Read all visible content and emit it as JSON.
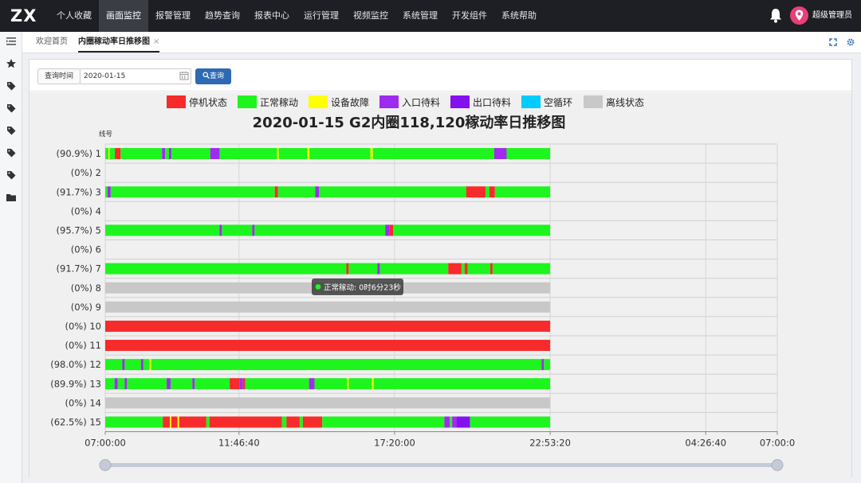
{
  "app": {
    "logo": "ZX",
    "username": "超级管理员"
  },
  "nav": {
    "items": [
      "个人收藏",
      "画面监控",
      "报警管理",
      "趋势查询",
      "报表中心",
      "运行管理",
      "视频监控",
      "系统管理",
      "开发组件",
      "系统帮助"
    ],
    "active_index": 1
  },
  "tabs": [
    {
      "label": "欢迎首页",
      "active": false
    },
    {
      "label": "内圈稼动率日推移图",
      "active": true,
      "close": "×"
    }
  ],
  "leftbar_icons": [
    "menu-toggle-icon",
    "star-icon",
    "tag-icon",
    "tag-icon",
    "tag-icon",
    "tag-icon",
    "tag-icon",
    "folder-icon"
  ],
  "query": {
    "label": "查询时间",
    "date_value": "2020-01-15",
    "button_label": "查询"
  },
  "colors": {
    "stop": "#f72b2b",
    "normal": "#1ef51e",
    "fault": "#ffff00",
    "in_wait": "#9f2bee",
    "out_wait": "#8410f0",
    "idle": "#00ccff",
    "offline": "#c8c8c8",
    "accent": "#2e6ab3"
  },
  "tooltip": {
    "text": "正常稼动: 0时6分23秒",
    "dot_color": "#1ef51e"
  },
  "chart_data": {
    "type": "gantt",
    "title": "2020-01-15 G2内圈118,120稼动率日推移图",
    "ylabel": "线号",
    "legend": [
      {
        "name": "停机状态",
        "key": "stop"
      },
      {
        "name": "正常稼动",
        "key": "normal"
      },
      {
        "name": "设备故障",
        "key": "fault"
      },
      {
        "name": "入口待料",
        "key": "in_wait"
      },
      {
        "name": "出口待料",
        "key": "out_wait"
      },
      {
        "name": "空循环",
        "key": "idle"
      },
      {
        "name": "离线状态",
        "key": "offline"
      }
    ],
    "legend_position": "top",
    "x_ticks": [
      "07:00:00",
      "11:46:40",
      "17:20:00",
      "22:53:20",
      "04:26:40",
      "07:00:0"
    ],
    "x_tick_seconds": [
      0,
      17200,
      37200,
      57200,
      77200,
      86400
    ],
    "x_range_seconds": [
      0,
      86400
    ],
    "data_end_seconds": 57200,
    "grid": true,
    "rows": [
      {
        "line": "1",
        "rate": "(90.9%)",
        "segments": [
          [
            "normal",
            0,
            420
          ],
          [
            "fault",
            420,
            560
          ],
          [
            "normal",
            560,
            1240
          ],
          [
            "stop",
            1240,
            1980
          ],
          [
            "normal",
            1980,
            7300
          ],
          [
            "in_wait",
            7300,
            7700
          ],
          [
            "normal",
            7700,
            8200
          ],
          [
            "in_wait",
            8200,
            8500
          ],
          [
            "normal",
            8500,
            13500
          ],
          [
            "in_wait",
            13500,
            14700
          ],
          [
            "normal",
            14700,
            22100
          ],
          [
            "fault",
            22100,
            22300
          ],
          [
            "normal",
            22300,
            26000
          ],
          [
            "fault",
            26000,
            26250
          ],
          [
            "normal",
            26250,
            34100
          ],
          [
            "fault",
            34100,
            34400
          ],
          [
            "normal",
            34400,
            50000
          ],
          [
            "in_wait",
            50000,
            51600
          ],
          [
            "normal",
            51600,
            57200
          ]
        ]
      },
      {
        "line": "2",
        "rate": "(0%)",
        "segments": []
      },
      {
        "line": "3",
        "rate": "(91.7%)",
        "segments": [
          [
            "normal",
            0,
            300
          ],
          [
            "in_wait",
            300,
            700
          ],
          [
            "normal",
            700,
            21800
          ],
          [
            "stop",
            21800,
            22200
          ],
          [
            "normal",
            22200,
            27000
          ],
          [
            "in_wait",
            27000,
            27500
          ],
          [
            "normal",
            27500,
            46400
          ],
          [
            "stop",
            46400,
            48900
          ],
          [
            "normal",
            48900,
            49400
          ],
          [
            "stop",
            49400,
            50100
          ],
          [
            "normal",
            50100,
            57200
          ]
        ]
      },
      {
        "line": "4",
        "rate": "(0%)",
        "segments": []
      },
      {
        "line": "5",
        "rate": "(95.7%)",
        "segments": [
          [
            "normal",
            0,
            14700
          ],
          [
            "in_wait",
            14700,
            15000
          ],
          [
            "normal",
            15000,
            18900
          ],
          [
            "in_wait",
            18900,
            19200
          ],
          [
            "normal",
            19200,
            36000
          ],
          [
            "in_wait",
            36000,
            36500
          ],
          [
            "stop",
            36500,
            37000
          ],
          [
            "normal",
            37000,
            57200
          ]
        ]
      },
      {
        "line": "6",
        "rate": "(0%)",
        "segments": []
      },
      {
        "line": "7",
        "rate": "(91.7%)",
        "segments": [
          [
            "normal",
            0,
            31000
          ],
          [
            "stop",
            31000,
            31300
          ],
          [
            "normal",
            31300,
            35000
          ],
          [
            "in_wait",
            35000,
            35300
          ],
          [
            "normal",
            35300,
            44100
          ],
          [
            "stop",
            44100,
            45800
          ],
          [
            "normal",
            45800,
            46200
          ],
          [
            "stop",
            46200,
            46600
          ],
          [
            "normal",
            46600,
            49500
          ],
          [
            "stop",
            49500,
            49800
          ],
          [
            "normal",
            49800,
            57200
          ]
        ]
      },
      {
        "line": "8",
        "rate": "(0%)",
        "segments": [
          [
            "offline",
            0,
            57200
          ]
        ]
      },
      {
        "line": "9",
        "rate": "(0%)",
        "segments": [
          [
            "offline",
            0,
            57200
          ]
        ]
      },
      {
        "line": "10",
        "rate": "(0%)",
        "segments": [
          [
            "stop",
            0,
            57200
          ]
        ]
      },
      {
        "line": "11",
        "rate": "(0%)",
        "segments": [
          [
            "stop",
            0,
            57200
          ]
        ]
      },
      {
        "line": "12",
        "rate": "(98.0%)",
        "segments": [
          [
            "normal",
            0,
            2200
          ],
          [
            "in_wait",
            2200,
            2500
          ],
          [
            "normal",
            2500,
            4600
          ],
          [
            "in_wait",
            4600,
            4900
          ],
          [
            "normal",
            4900,
            5700
          ],
          [
            "fault",
            5700,
            5900
          ],
          [
            "normal",
            5900,
            56100
          ],
          [
            "in_wait",
            56100,
            56400
          ],
          [
            "normal",
            56400,
            57200
          ]
        ]
      },
      {
        "line": "13",
        "rate": "(89.9%)",
        "segments": [
          [
            "normal",
            0,
            1200
          ],
          [
            "in_wait",
            1200,
            1600
          ],
          [
            "normal",
            1600,
            2500
          ],
          [
            "in_wait",
            2500,
            2800
          ],
          [
            "normal",
            2800,
            7900
          ],
          [
            "in_wait",
            7900,
            8400
          ],
          [
            "normal",
            8400,
            11200
          ],
          [
            "in_wait",
            11200,
            11500
          ],
          [
            "normal",
            11500,
            16000
          ],
          [
            "stop",
            16000,
            17300
          ],
          [
            "in_wait",
            17300,
            17700
          ],
          [
            "stop",
            17700,
            18000
          ],
          [
            "normal",
            18000,
            26200
          ],
          [
            "in_wait",
            26200,
            26900
          ],
          [
            "normal",
            26900,
            31100
          ],
          [
            "fault",
            31100,
            31300
          ],
          [
            "normal",
            31300,
            34300
          ],
          [
            "fault",
            34300,
            34500
          ],
          [
            "normal",
            34500,
            57200
          ]
        ]
      },
      {
        "line": "14",
        "rate": "(0%)",
        "segments": [
          [
            "offline",
            0,
            57200
          ]
        ]
      },
      {
        "line": "15",
        "rate": "(62.5%)",
        "segments": [
          [
            "normal",
            0,
            7400
          ],
          [
            "stop",
            7400,
            8300
          ],
          [
            "fault",
            8300,
            8500
          ],
          [
            "stop",
            8500,
            9300
          ],
          [
            "fault",
            9300,
            9500
          ],
          [
            "stop",
            9500,
            13000
          ],
          [
            "normal",
            13000,
            13400
          ],
          [
            "stop",
            13400,
            22700
          ],
          [
            "normal",
            22700,
            23300
          ],
          [
            "stop",
            23300,
            25000
          ],
          [
            "normal",
            25000,
            25400
          ],
          [
            "stop",
            25400,
            27900
          ],
          [
            "normal",
            27900,
            43600
          ],
          [
            "in_wait",
            43600,
            44300
          ],
          [
            "normal",
            44300,
            44600
          ],
          [
            "in_wait",
            44600,
            45200
          ],
          [
            "out_wait",
            45200,
            46900
          ],
          [
            "normal",
            46900,
            57200
          ]
        ]
      }
    ]
  }
}
